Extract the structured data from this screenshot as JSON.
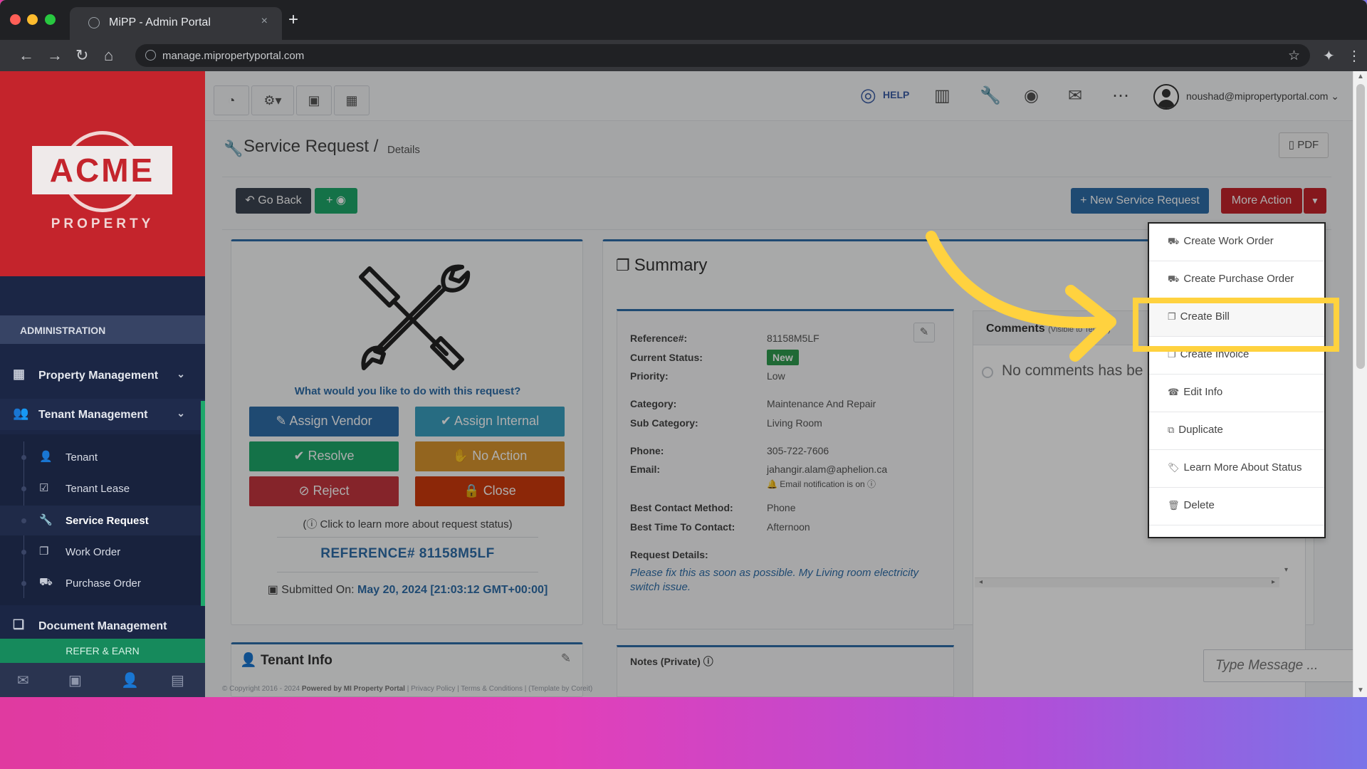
{
  "browser": {
    "tab_title": "MiPP - Admin Portal",
    "tab_close": "×",
    "new_tab": "+",
    "url": "manage.mipropertyportal.com"
  },
  "sidebar": {
    "logo_text": "ACME",
    "logo_sub": "PROPERTY",
    "section_header": "ADMINISTRATION",
    "property_management": "Property Management",
    "tenant_management": "Tenant Management",
    "sub_items": [
      {
        "label": "Tenant"
      },
      {
        "label": "Tenant Lease"
      },
      {
        "label": "Service Request"
      },
      {
        "label": "Work Order"
      },
      {
        "label": "Purchase Order"
      }
    ],
    "document_management": "Document Management",
    "refer": "REFER & EARN"
  },
  "topbar": {
    "help": "HELP",
    "user_email": "noushad@mipropertyportal.com"
  },
  "page": {
    "title": "Service Request",
    "separator": "/",
    "subtitle": "Details",
    "pdf": "PDF",
    "go_back": "Go Back",
    "plus_eye": "+",
    "new_service_request": "New Service Request",
    "more_action": "More Action"
  },
  "actions": {
    "question": "What would you like to do with this request?",
    "assign_vendor": "Assign Vendor",
    "assign_internal": "Assign Internal",
    "resolve": "Resolve",
    "no_action": "No Action",
    "reject": "Reject",
    "close": "Close",
    "learn_more": "Click to learn more about request status)",
    "reference": "REFERENCE# 81158M5LF",
    "submitted_label": "Submitted On:",
    "submitted_value": "May 20, 2024 [21:03:12 GMT+00:00]"
  },
  "tenant_info": {
    "title": "Tenant Info"
  },
  "summary": {
    "title": "Summary",
    "reference_label": "Reference#:",
    "reference_value": "81158M5LF",
    "status_label": "Current Status:",
    "status_value": "New",
    "priority_label": "Priority:",
    "priority_value": "Low",
    "category_label": "Category:",
    "category_value": "Maintenance And Repair",
    "subcategory_label": "Sub Category:",
    "subcategory_value": "Living Room",
    "phone_label": "Phone:",
    "phone_value": "305-722-7606",
    "email_label": "Email:",
    "email_value": "jahangir.alam@aphelion.ca",
    "email_notification": "Email notification is on",
    "contact_method_label": "Best Contact Method:",
    "contact_method_value": "Phone",
    "contact_time_label": "Best Time To Contact:",
    "contact_time_value": "Afternoon",
    "request_details_label": "Request Details:",
    "request_details_value": "Please fix this as soon as possible. My Living room electricity switch issue."
  },
  "notes": {
    "title": "Notes (Private)"
  },
  "comments": {
    "title": "Comments",
    "visibility": "(Visible to Tenant)",
    "empty": "No comments has be",
    "message_placeholder": "Type Message ..."
  },
  "dropdown": {
    "items": [
      {
        "label": "Create Work Order"
      },
      {
        "label": "Create Purchase Order"
      },
      {
        "label": "Create Bill"
      },
      {
        "label": "Create Invoice"
      },
      {
        "label": "Edit Info"
      },
      {
        "label": "Duplicate"
      },
      {
        "label": "Learn More About Status"
      },
      {
        "label": "Delete"
      }
    ],
    "highlighted": "Create Bill"
  },
  "footer": {
    "copyright": "© Copyright 2016 - 2024",
    "powered": "Powered by MI Property Portal",
    "links": "| Privacy Policy | Terms & Conditions |",
    "theme": "(Template by Coreit)"
  },
  "colors": {
    "brand_red": "#c4242c",
    "navy": "#1b2645",
    "primary_blue": "#2f6ea8",
    "success_green": "#1ea86b",
    "highlight_yellow": "#ffd23f"
  }
}
